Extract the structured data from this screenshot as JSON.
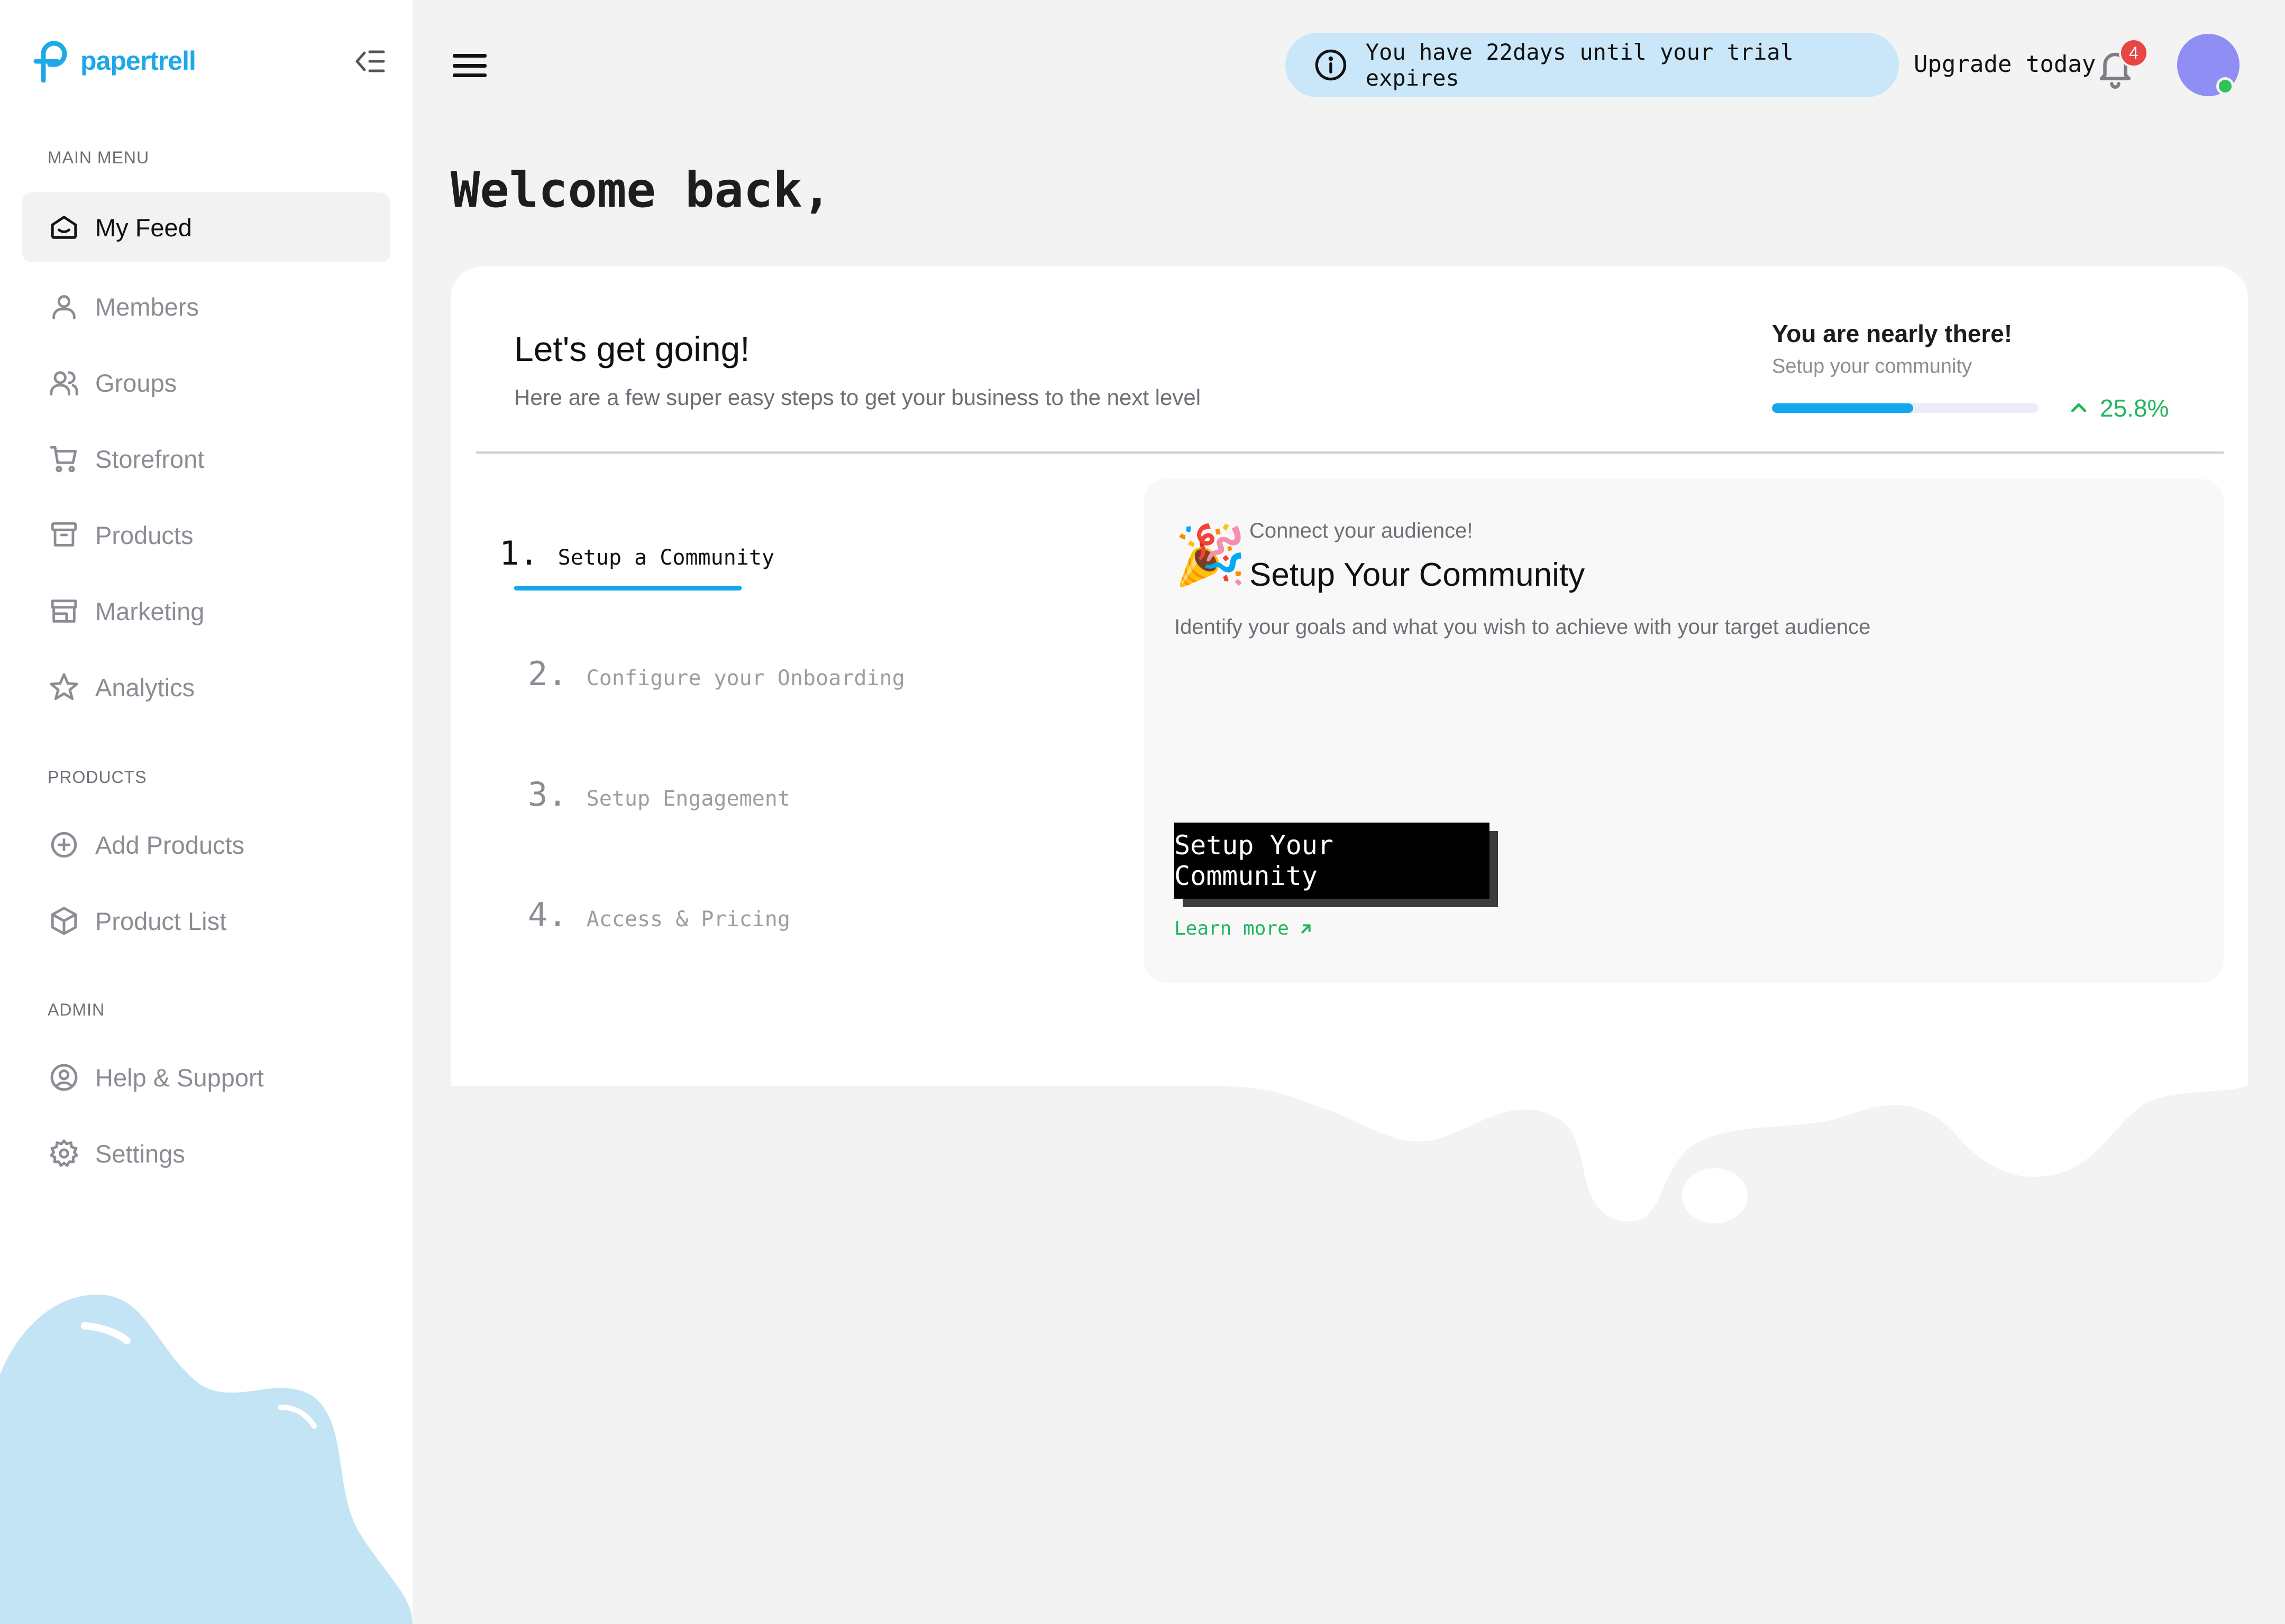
{
  "brand": {
    "name": "papertrell",
    "color": "#1da9e8"
  },
  "sidebar": {
    "main_menu_label": "MAIN MENU",
    "products_label": "PRODUCTS",
    "admin_label": "ADMIN",
    "main_items": [
      {
        "label": "My Feed",
        "icon": "home-icon",
        "active": true
      },
      {
        "label": "Members",
        "icon": "user-icon"
      },
      {
        "label": "Groups",
        "icon": "users-icon"
      },
      {
        "label": "Storefront",
        "icon": "cart-icon"
      },
      {
        "label": "Products",
        "icon": "archive-icon"
      },
      {
        "label": "Marketing",
        "icon": "store-icon"
      },
      {
        "label": "Analytics",
        "icon": "star-icon"
      }
    ],
    "product_items": [
      {
        "label": "Add Products",
        "icon": "plus-circle-icon"
      },
      {
        "label": "Product List",
        "icon": "box-icon"
      }
    ],
    "admin_items": [
      {
        "label": "Help & Support",
        "icon": "user-circle-icon"
      },
      {
        "label": "Settings",
        "icon": "gear-icon"
      }
    ]
  },
  "header": {
    "trial_message": "You have 22days until your trial expires",
    "upgrade_label": "Upgrade today",
    "notification_count": "4"
  },
  "welcome": "Welcome back,",
  "onboarding": {
    "title": "Let's get going!",
    "subtitle": "Here are a few super easy steps to get your business to the next level",
    "progress": {
      "title": "You are nearly there!",
      "subtitle": "Setup your community",
      "percent_label": "25.8%",
      "value": 0.53
    },
    "steps": [
      {
        "num": "1.",
        "label": "Setup a Community",
        "active": true
      },
      {
        "num": "2.",
        "label": "Configure your Onboarding"
      },
      {
        "num": "3.",
        "label": "Setup Engagement"
      },
      {
        "num": "4.",
        "label": "Access & Pricing"
      }
    ],
    "panel": {
      "emoji": "🎉",
      "kicker": "Connect your audience!",
      "title": "Setup Your Community",
      "description": "Identify your goals and what you wish to achieve with your target audience",
      "cta_label": "Setup Your Community",
      "learn_more": "Learn more"
    }
  },
  "colors": {
    "accent": "#12a7ec",
    "success": "#20b55d",
    "badge": "#e84545",
    "avatar": "#8f8ef5"
  }
}
